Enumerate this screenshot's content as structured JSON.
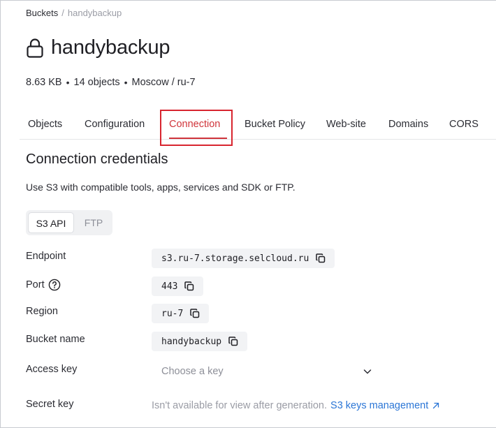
{
  "breadcrumb": {
    "root": "Buckets",
    "separator": "/",
    "current": "handybackup"
  },
  "bucket": {
    "name": "handybackup",
    "size": "8.63 KB",
    "objects": "14 objects",
    "location": "Moscow / ru-7",
    "separator": "•"
  },
  "tabs": [
    {
      "label": "Objects"
    },
    {
      "label": "Configuration"
    },
    {
      "label": "Connection",
      "active": true
    },
    {
      "label": "Bucket Policy"
    },
    {
      "label": "Web-site"
    },
    {
      "label": "Domains"
    },
    {
      "label": "CORS"
    }
  ],
  "section": {
    "title": "Connection credentials",
    "subtitle": "Use S3 with compatible tools, apps, services and SDK or FTP."
  },
  "protocol_toggle": {
    "options": [
      "S3 API",
      "FTP"
    ],
    "selected": "S3 API"
  },
  "fields": {
    "endpoint": {
      "label": "Endpoint",
      "value": "s3.ru-7.storage.selcloud.ru"
    },
    "port": {
      "label": "Port",
      "value": "443"
    },
    "region": {
      "label": "Region",
      "value": "ru-7"
    },
    "bucket_name": {
      "label": "Bucket name",
      "value": "handybackup"
    },
    "access_key": {
      "label": "Access key",
      "placeholder": "Choose a key"
    },
    "secret_key": {
      "label": "Secret key",
      "note": "Isn't available for view after generation.",
      "link": "S3 keys management"
    }
  },
  "colors": {
    "accent": "#d0343a",
    "link": "#2b76d6",
    "highlight_box": "#d8252f"
  },
  "icons": [
    "lock-icon",
    "help-circle-icon",
    "copy-icon",
    "chevron-down-icon",
    "external-link-icon"
  ]
}
